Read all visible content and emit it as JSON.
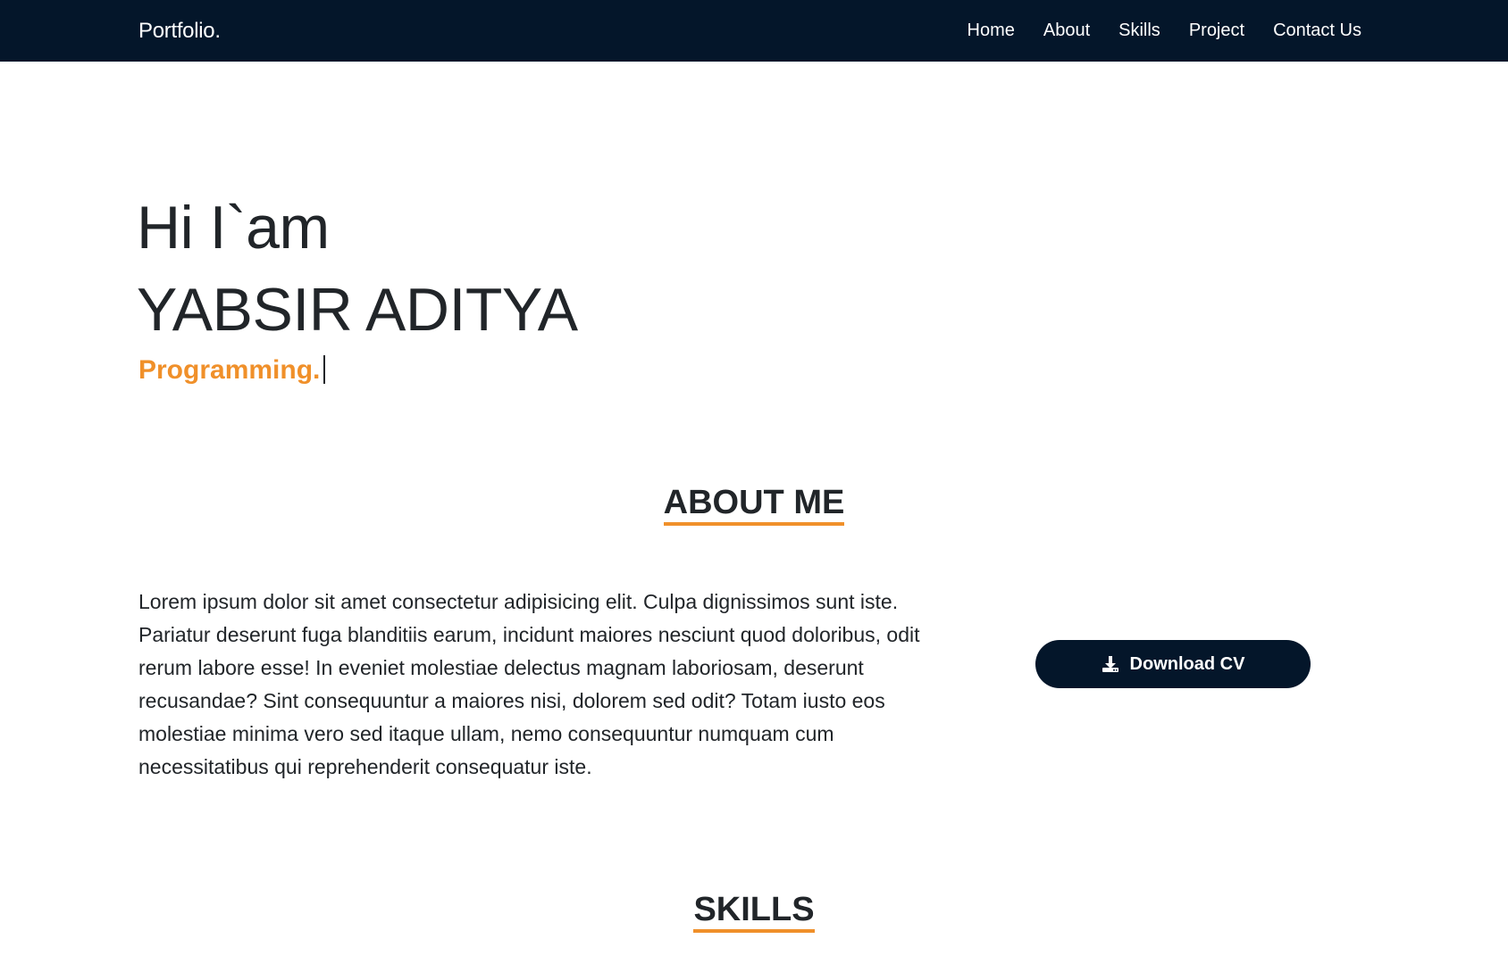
{
  "navbar": {
    "brand": "Portfolio.",
    "links": [
      "Home",
      "About",
      "Skills",
      "Project",
      "Contact Us"
    ],
    "background": "#04162a"
  },
  "hero": {
    "greeting": "Hi I`am",
    "name": "YABSIR ADITYA",
    "role": "Programming."
  },
  "about": {
    "title": "ABOUT ME",
    "text": "Lorem ipsum dolor sit amet consectetur adipisicing elit. Culpa dignissimos sunt iste. Pariatur deserunt fuga blanditiis earum, incidunt maiores nesciunt quod doloribus, odit rerum labore esse! In eveniet molestiae delectus magnam laboriosam, deserunt recusandae? Sint consequuntur a maiores nisi, dolorem sed odit? Totam iusto eos molestiae minima vero sed itaque ullam, nemo consequuntur numquam cum necessitatibus qui reprehenderit consequatur iste.",
    "download_label": "Download CV",
    "download_icon": "download-icon"
  },
  "skills": {
    "title": "SKILLS"
  },
  "colors": {
    "accent": "#f0902a",
    "dark": "#04162a",
    "text": "#212529"
  }
}
